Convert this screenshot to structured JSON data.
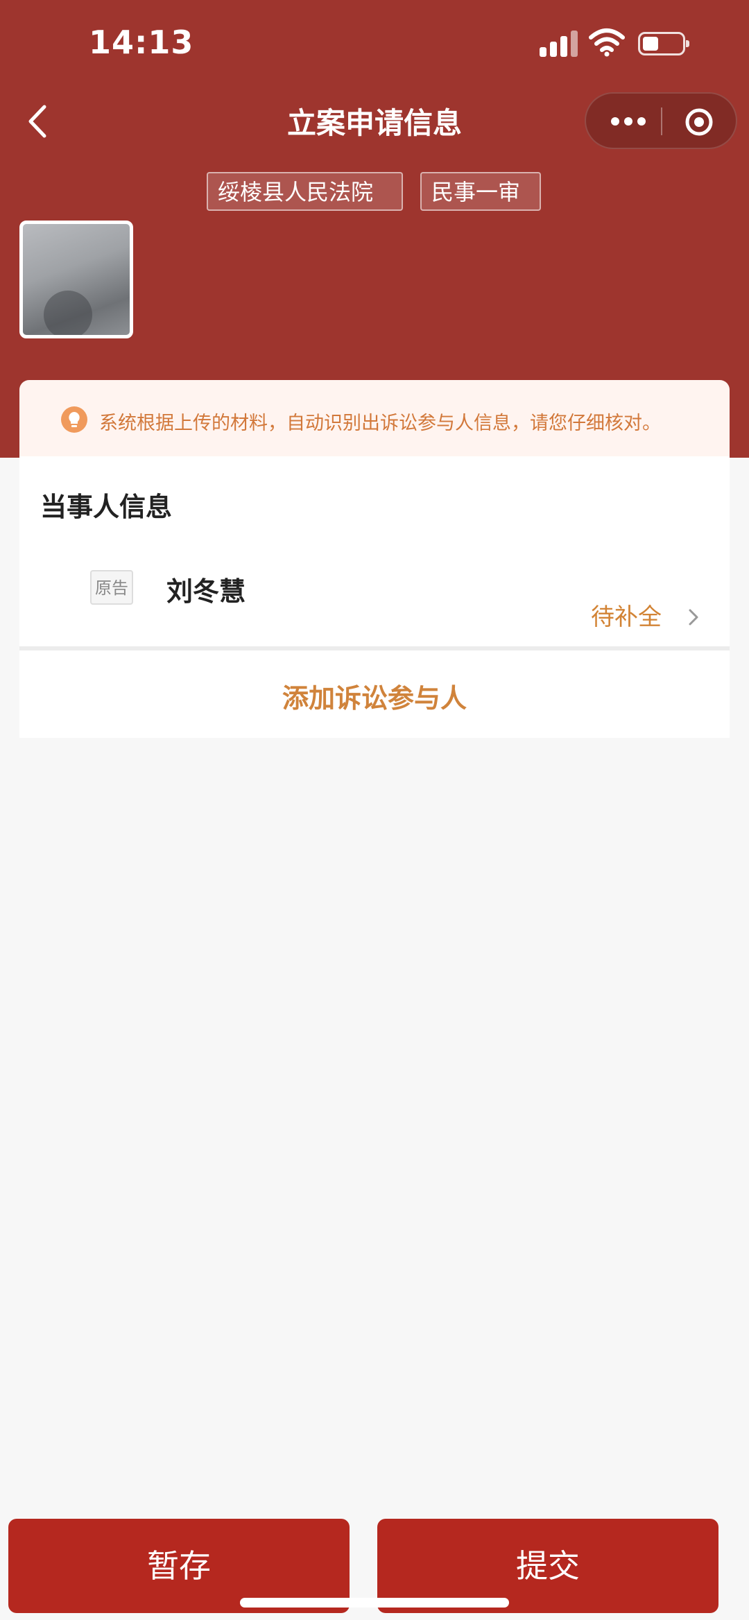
{
  "status_bar": {
    "time": "14:13",
    "icons": [
      "signal-icon",
      "wifi-icon",
      "battery-icon"
    ]
  },
  "nav": {
    "title": "立案申请信息",
    "back_icon": "chevron-left-icon",
    "capsule_icons": [
      "more-dots-icon",
      "target-icon"
    ]
  },
  "tags": {
    "court": "绥棱县人民法院",
    "case_type": "民事一审"
  },
  "notice": {
    "icon": "lightbulb-icon",
    "text": "系统根据上传的材料，自动识别出诉讼参与人信息，请您仔细核对。"
  },
  "parties": {
    "section_title": "当事人信息",
    "items": [
      {
        "role": "原告",
        "name": "刘冬慧",
        "status": "待补全"
      }
    ],
    "add_label": "添加诉讼参与人"
  },
  "actions": {
    "save_label": "暂存",
    "submit_label": "提交"
  },
  "colors": {
    "header": "#9e352e",
    "button": "#b5281f",
    "accent_orange": "#d0833b",
    "notice_bg": "#fff4f0"
  }
}
